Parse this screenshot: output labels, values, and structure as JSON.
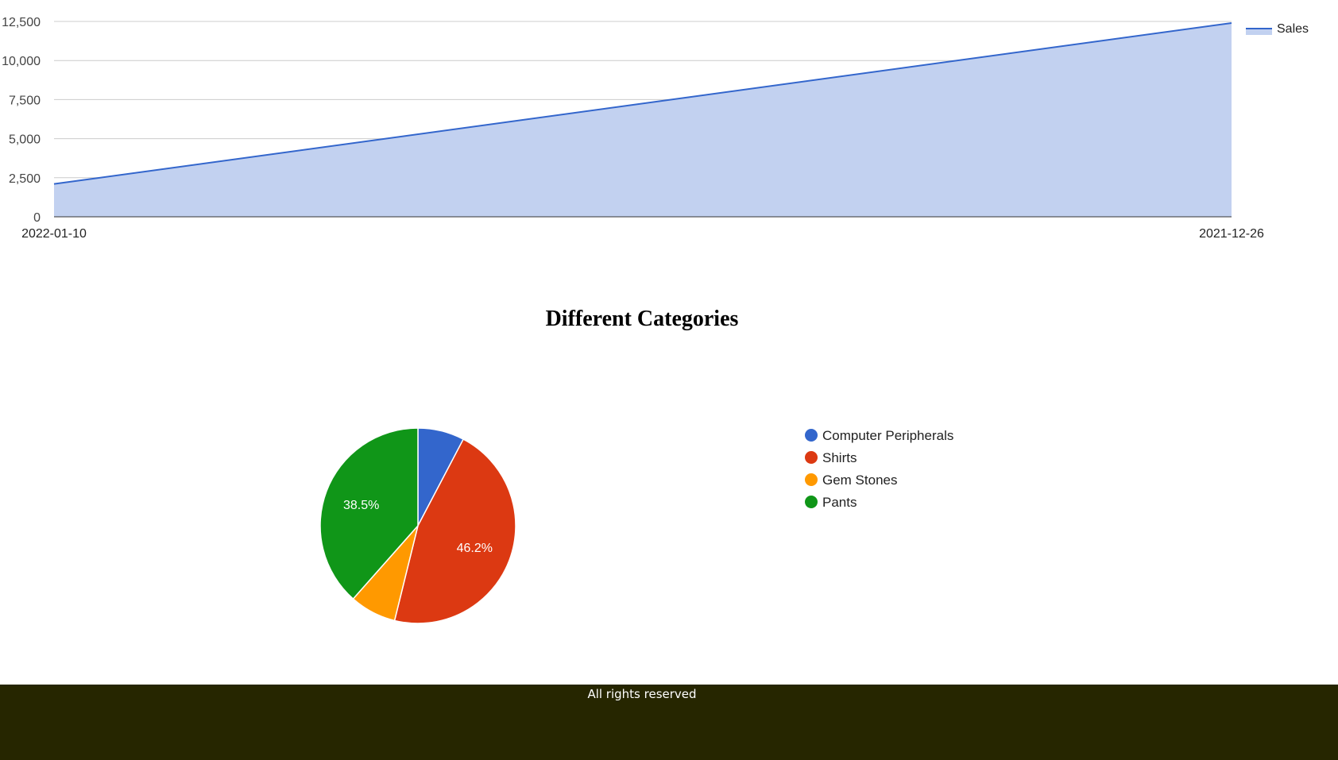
{
  "chart_data": [
    {
      "type": "area",
      "x": [
        "2022-01-10",
        "2021-12-26"
      ],
      "series": [
        {
          "name": "Sales",
          "values": [
            2100,
            12400
          ]
        }
      ],
      "ylim": [
        0,
        12500
      ],
      "yticks": [
        "0",
        "2,500",
        "5,000",
        "7,500",
        "10,000",
        "12,500"
      ],
      "grid": true,
      "legend": "right",
      "colors": {
        "line": "#3366cc",
        "fill": "#c2d1f0"
      }
    },
    {
      "type": "pie",
      "title": "Different Categories",
      "labels": [
        "Computer Peripherals",
        "Shirts",
        "Gem Stones",
        "Pants"
      ],
      "values": [
        7.7,
        46.2,
        7.7,
        38.5
      ],
      "data_labels": [
        "",
        "46.2%",
        "",
        "38.5%"
      ],
      "colors": [
        "#3366cc",
        "#dc3912",
        "#ff9900",
        "#109618"
      ],
      "legend": "right"
    }
  ],
  "footer": {
    "text": "All rights reserved",
    "background": "#262600"
  }
}
